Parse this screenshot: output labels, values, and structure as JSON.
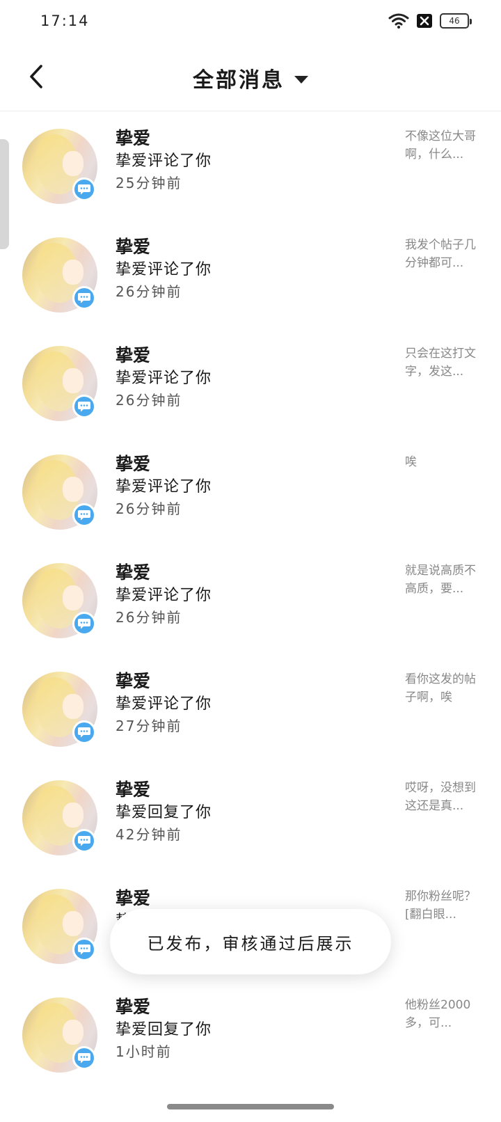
{
  "status_bar": {
    "time": "17:14",
    "battery": "46"
  },
  "header": {
    "title": "全部消息"
  },
  "messages": [
    {
      "name": "挚爱",
      "action": "挚爱评论了你",
      "time": "25分钟前",
      "preview": "不像这位大哥啊，什么..."
    },
    {
      "name": "挚爱",
      "action": "挚爱评论了你",
      "time": "26分钟前",
      "preview": "我发个帖子几分钟都可..."
    },
    {
      "name": "挚爱",
      "action": "挚爱评论了你",
      "time": "26分钟前",
      "preview": "只会在这打文字，发这..."
    },
    {
      "name": "挚爱",
      "action": "挚爱评论了你",
      "time": "26分钟前",
      "preview": "唉"
    },
    {
      "name": "挚爱",
      "action": "挚爱评论了你",
      "time": "26分钟前",
      "preview": "就是说高质不高质，要..."
    },
    {
      "name": "挚爱",
      "action": "挚爱评论了你",
      "time": "27分钟前",
      "preview": "看你这发的帖子啊，唉"
    },
    {
      "name": "挚爱",
      "action": "挚爱回复了你",
      "time": "42分钟前",
      "preview": "哎呀，没想到这还是真..."
    },
    {
      "name": "挚爱",
      "action": "挚",
      "time": "",
      "preview": "那你粉丝呢？[翻白眼..."
    },
    {
      "name": "挚爱",
      "action": "挚爱回复了你",
      "time": "1小时前",
      "preview": "他粉丝2000多，可..."
    }
  ],
  "toast": {
    "text": "已发布，审核通过后展示"
  },
  "icons": {
    "back": "back-arrow-icon",
    "dropdown": "dropdown-triangle-icon",
    "badge": "comment-bubble-icon",
    "wifi": "wifi-icon",
    "notification": "close-box-icon"
  },
  "colors": {
    "badge": "#4aa9ee",
    "preview_text": "#888888"
  }
}
